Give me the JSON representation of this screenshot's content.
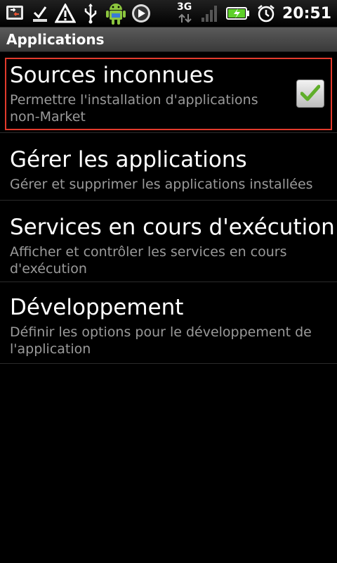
{
  "status_bar": {
    "time": "20:51",
    "network_label": "3G",
    "icons": [
      "usb-debug-icon",
      "download-complete-icon",
      "warning-icon",
      "usb-icon",
      "android-icon",
      "media-player-icon",
      "signal-icon",
      "battery-charging-icon",
      "alarm-icon"
    ]
  },
  "header": {
    "title": "Applications"
  },
  "settings": {
    "unknown_sources": {
      "title": "Sources inconnues",
      "summary": "Permettre l'installation d'applications non-Market",
      "checked": true
    },
    "manage_apps": {
      "title": "Gérer les applications",
      "summary": "Gérer et supprimer les applications installées"
    },
    "running_services": {
      "title": "Services en cours d'exécution",
      "summary": "Afficher et contrôler les services en cours d'exécution"
    },
    "development": {
      "title": "Développement",
      "summary": "Définir les options pour le développement de l'application"
    }
  },
  "colors": {
    "highlight": "#e23a2c",
    "check": "#5fae2a"
  }
}
